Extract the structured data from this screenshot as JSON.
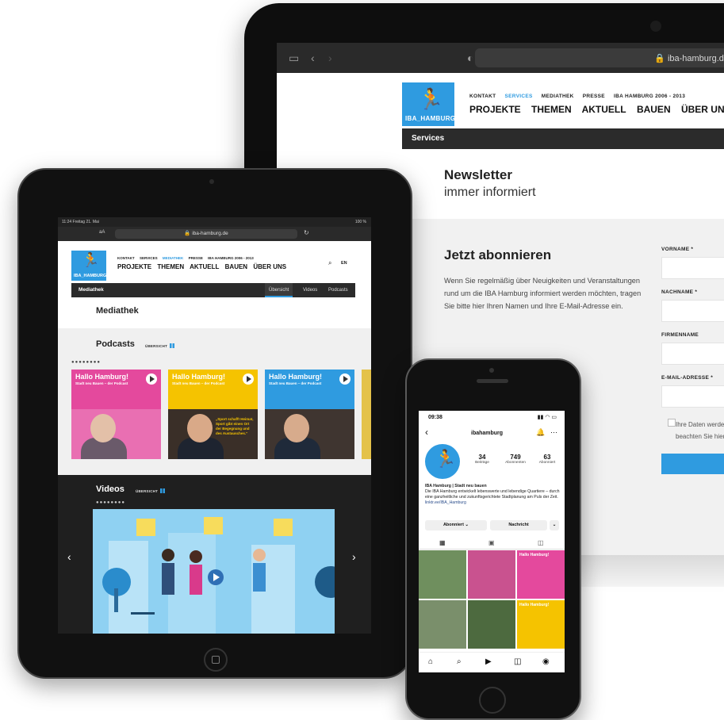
{
  "colors": {
    "brand_blue": "#2f9be0",
    "pink": "#e4499d",
    "yellow": "#f5c300",
    "dark": "#2b2b2b"
  },
  "laptop": {
    "url": "iba-hamburg.de",
    "logo_text": "IBA_HAMBURG",
    "topnav": [
      "KONTAKT",
      "SERVICES",
      "MEDIATHEK",
      "PRESSE",
      "IBA HAMBURG 2006 - 2013"
    ],
    "mainnav": [
      "PROJEKTE",
      "THEMEN",
      "AKTUELL",
      "BAUEN",
      "ÜBER UNS"
    ],
    "section_bar": "Services",
    "title": "Newsletter",
    "subtitle": "immer informiert",
    "form_heading": "Jetzt abonnieren",
    "form_text": "Wenn Sie regelmäßig über Neuigkeiten und Veranstaltungen rund um die IBA Hamburg informiert werden möchten, tragen Sie bitte hier Ihren Namen und Ihre E-Mail-Adresse ein.",
    "fields": [
      "VORNAME *",
      "NACHNAME *",
      "FIRMENNAME",
      "E-MAIL-ADRESSE *"
    ],
    "consent_line1": "Ihre Daten werde",
    "consent_line2": "beachten Sie hier"
  },
  "tablet": {
    "status_time": "11:24  Freitag 21. Mai",
    "status_battery": "100 %",
    "url": "iba-hamburg.de",
    "font_btn": "aA",
    "logo_text": "IBA_HAMBURG",
    "topnav": [
      "KONTAKT",
      "SERVICES",
      "MEDIATHEK",
      "PRESSE",
      "IBA HAMBURG 2006 - 2013"
    ],
    "mainnav": [
      "PROJEKTE",
      "THEMEN",
      "AKTUELL",
      "BAUEN",
      "ÜBER UNS"
    ],
    "lang": "EN",
    "section_bar": "Mediathek",
    "tabs": [
      "Übersicht",
      "Videos",
      "Podcasts"
    ],
    "heading": "Mediathek",
    "podcasts": {
      "heading": "Podcasts",
      "overview_label": "ÜBERSICHT",
      "dots": "●●●●●●●●",
      "cards": [
        {
          "title": "Hallo Hamburg!",
          "subtitle": "Stadt neu Bauen – der Podcast",
          "color": "#e4499d"
        },
        {
          "title": "Hallo Hamburg!",
          "subtitle": "Stadt neu Bauen – der Podcast",
          "quote": "„Sport schafft Heimat, Sport gibt einen Ort der Begegnung und des Austausches.“",
          "color": "#f5c300"
        },
        {
          "title": "Hallo Hamburg!",
          "subtitle": "Stadt neu Bauen – der Podcast",
          "color": "#2f9be0"
        }
      ]
    },
    "videos": {
      "heading": "Videos",
      "overview_label": "ÜBERSICHT",
      "dots": "●●●●●●●●"
    }
  },
  "phone": {
    "time": "09:38",
    "username": "ibahamburg",
    "stats": [
      {
        "value": "34",
        "label": "Beiträge"
      },
      {
        "value": "749",
        "label": "Abonnenten"
      },
      {
        "value": "63",
        "label": "Abonniert"
      }
    ],
    "bio_name": "IBA Hamburg | Stadt neu bauen",
    "bio_text": "Die IBA Hamburg entwickelt lebenswerte und lebendige Quartiere – durch eine ganzheitliche und zukunftsgerichtete Stadtplanung am Puls der Zeit.",
    "bio_link": "linktr.ee/IBA_Hamburg",
    "btn_following": "Abonniert ⌄",
    "btn_message": "Nachricht",
    "grid_title": "Hallo Hamburg!"
  }
}
